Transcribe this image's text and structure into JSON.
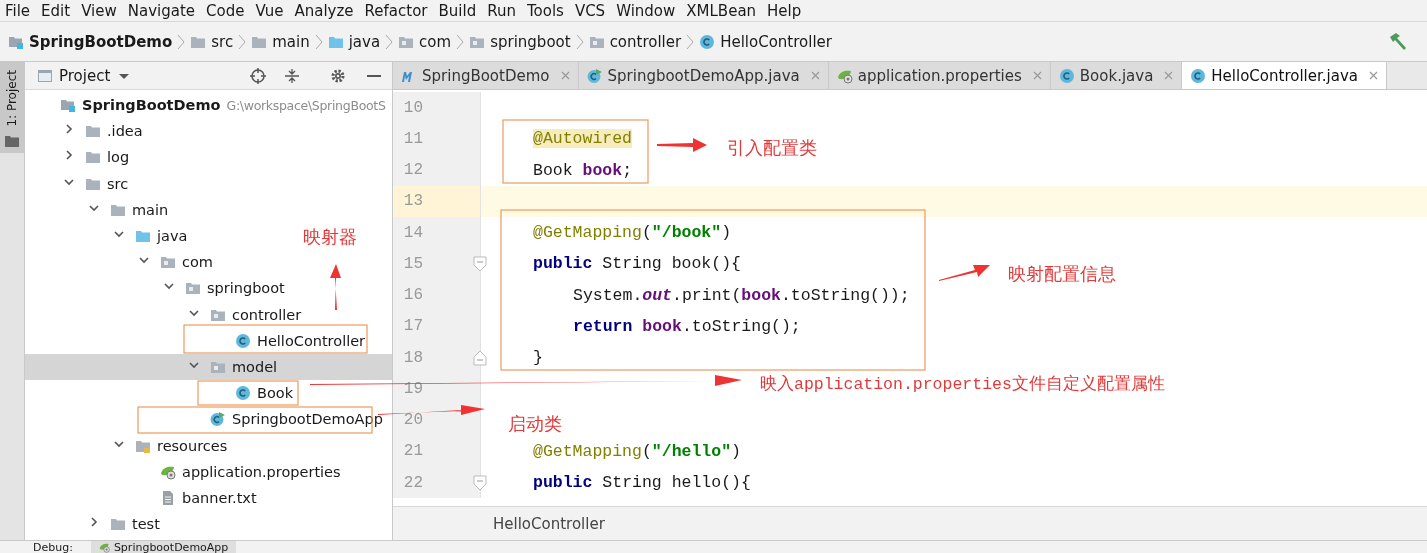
{
  "menu": [
    "File",
    "Edit",
    "View",
    "Navigate",
    "Code",
    "Vue",
    "Analyze",
    "Refactor",
    "Build",
    "Run",
    "Tools",
    "VCS",
    "Window",
    "XMLBean",
    "Help"
  ],
  "breadcrumb": [
    {
      "label": "SpringBootDemo",
      "kind": "module"
    },
    {
      "label": "src",
      "kind": "folder"
    },
    {
      "label": "main",
      "kind": "folder"
    },
    {
      "label": "java",
      "kind": "source"
    },
    {
      "label": "com",
      "kind": "package"
    },
    {
      "label": "springboot",
      "kind": "package"
    },
    {
      "label": "controller",
      "kind": "package"
    },
    {
      "label": "HelloController",
      "kind": "class"
    }
  ],
  "tool_stripe": {
    "label": "1: Project"
  },
  "project_panel": {
    "title": "Project",
    "tree": [
      {
        "label": "SpringBootDemo",
        "hint": "G:\\workspace\\SpringBootS",
        "kind": "module",
        "selected": false,
        "children": [
          {
            "label": ".idea",
            "kind": "folder",
            "expanded": false,
            "selected": false
          },
          {
            "label": "log",
            "kind": "folder",
            "expanded": false,
            "selected": false
          },
          {
            "label": "src",
            "kind": "folder",
            "expanded": true,
            "selected": false,
            "children": [
              {
                "label": "main",
                "kind": "folder",
                "expanded": true,
                "selected": false,
                "children": [
                  {
                    "label": "java",
                    "kind": "source",
                    "expanded": true,
                    "selected": false,
                    "children": [
                      {
                        "label": "com",
                        "kind": "package",
                        "expanded": true,
                        "selected": false,
                        "children": [
                          {
                            "label": "springboot",
                            "kind": "package",
                            "expanded": true,
                            "selected": false,
                            "children": [
                              {
                                "label": "controller",
                                "kind": "package",
                                "expanded": true,
                                "selected": false,
                                "children": [
                                  {
                                    "label": "HelloController",
                                    "kind": "class",
                                    "selected": false
                                  }
                                ]
                              },
                              {
                                "label": "model",
                                "kind": "package",
                                "expanded": true,
                                "selected": true,
                                "children": [
                                  {
                                    "label": "Book",
                                    "kind": "class",
                                    "selected": false
                                  }
                                ]
                              },
                              {
                                "label": "SpringbootDemoApp",
                                "kind": "app",
                                "selected": false
                              }
                            ]
                          }
                        ]
                      }
                    ]
                  },
                  {
                    "label": "resources",
                    "kind": "resources",
                    "expanded": true,
                    "selected": false,
                    "children": [
                      {
                        "label": "application.properties",
                        "kind": "properties",
                        "selected": false
                      },
                      {
                        "label": "banner.txt",
                        "kind": "text",
                        "selected": false
                      }
                    ]
                  }
                ]
              },
              {
                "label": "test",
                "kind": "folder",
                "expanded": false,
                "selected": false
              }
            ]
          }
        ]
      }
    ]
  },
  "tabs": [
    {
      "label": "SpringBootDemo",
      "kind": "maven",
      "selected": false
    },
    {
      "label": "SpringbootDemoApp.java",
      "kind": "app",
      "selected": false
    },
    {
      "label": "application.properties",
      "kind": "properties",
      "selected": false
    },
    {
      "label": "Book.java",
      "kind": "class",
      "selected": false
    },
    {
      "label": "HelloController.java",
      "kind": "class",
      "selected": true
    }
  ],
  "editor": {
    "lines": [
      {
        "number": "10",
        "current": false
      },
      {
        "number": "11",
        "current": false,
        "kind": "member",
        "tokens": [
          {
            "kind": "annotation",
            "text": "@Autowired",
            "highlighted": true
          }
        ]
      },
      {
        "number": "12",
        "current": false,
        "kind": "member",
        "tokens": [
          {
            "kind": "plain",
            "text": "Book "
          },
          {
            "kind": "field",
            "text": "book"
          },
          {
            "kind": "plain",
            "text": ";"
          }
        ]
      },
      {
        "number": "13",
        "current": true
      },
      {
        "number": "14",
        "current": false,
        "kind": "member",
        "tokens": [
          {
            "kind": "annotation",
            "text": "@GetMapping"
          },
          {
            "kind": "plain",
            "text": "("
          },
          {
            "kind": "string",
            "text": "\"/book\""
          },
          {
            "kind": "plain",
            "text": ")"
          }
        ]
      },
      {
        "number": "15",
        "current": false,
        "kind": "method-start",
        "tokens": [
          {
            "kind": "keyword",
            "text": "public"
          },
          {
            "kind": "plain",
            "text": " String book(){"
          }
        ]
      },
      {
        "number": "16",
        "current": false,
        "kind": "statement",
        "tokens": [
          {
            "kind": "plain",
            "text": "System."
          },
          {
            "kind": "static",
            "text": "out"
          },
          {
            "kind": "plain",
            "text": ".print("
          },
          {
            "kind": "field",
            "text": "book"
          },
          {
            "kind": "plain",
            "text": ".toString());"
          }
        ]
      },
      {
        "number": "17",
        "current": false,
        "kind": "statement",
        "tokens": [
          {
            "kind": "keyword",
            "text": "return "
          },
          {
            "kind": "field",
            "text": "book"
          },
          {
            "kind": "plain",
            "text": ".toString();"
          }
        ]
      },
      {
        "number": "18",
        "current": false,
        "kind": "method-end",
        "tokens": [
          {
            "kind": "plain",
            "text": "}"
          }
        ]
      },
      {
        "number": "19",
        "current": false
      },
      {
        "number": "20",
        "current": false
      },
      {
        "number": "21",
        "current": false,
        "kind": "member",
        "tokens": [
          {
            "kind": "annotation",
            "text": "@GetMapping"
          },
          {
            "kind": "plain",
            "text": "("
          },
          {
            "kind": "string",
            "text": "\"/hello\""
          },
          {
            "kind": "plain",
            "text": ")"
          }
        ]
      },
      {
        "number": "22",
        "current": false,
        "kind": "method-start",
        "tokens": [
          {
            "kind": "keyword",
            "text": "public"
          },
          {
            "kind": "plain",
            "text": " String hello(){"
          }
        ]
      }
    ],
    "footer": "HelloController"
  },
  "annotations": [
    "引入配置类",
    "映射器",
    "映射配置信息",
    "映入application.properties文件自定义配置属性",
    "启动类"
  ],
  "debug_bar": {
    "label": "Debug:",
    "tab": "SpringbootDemoApp"
  }
}
